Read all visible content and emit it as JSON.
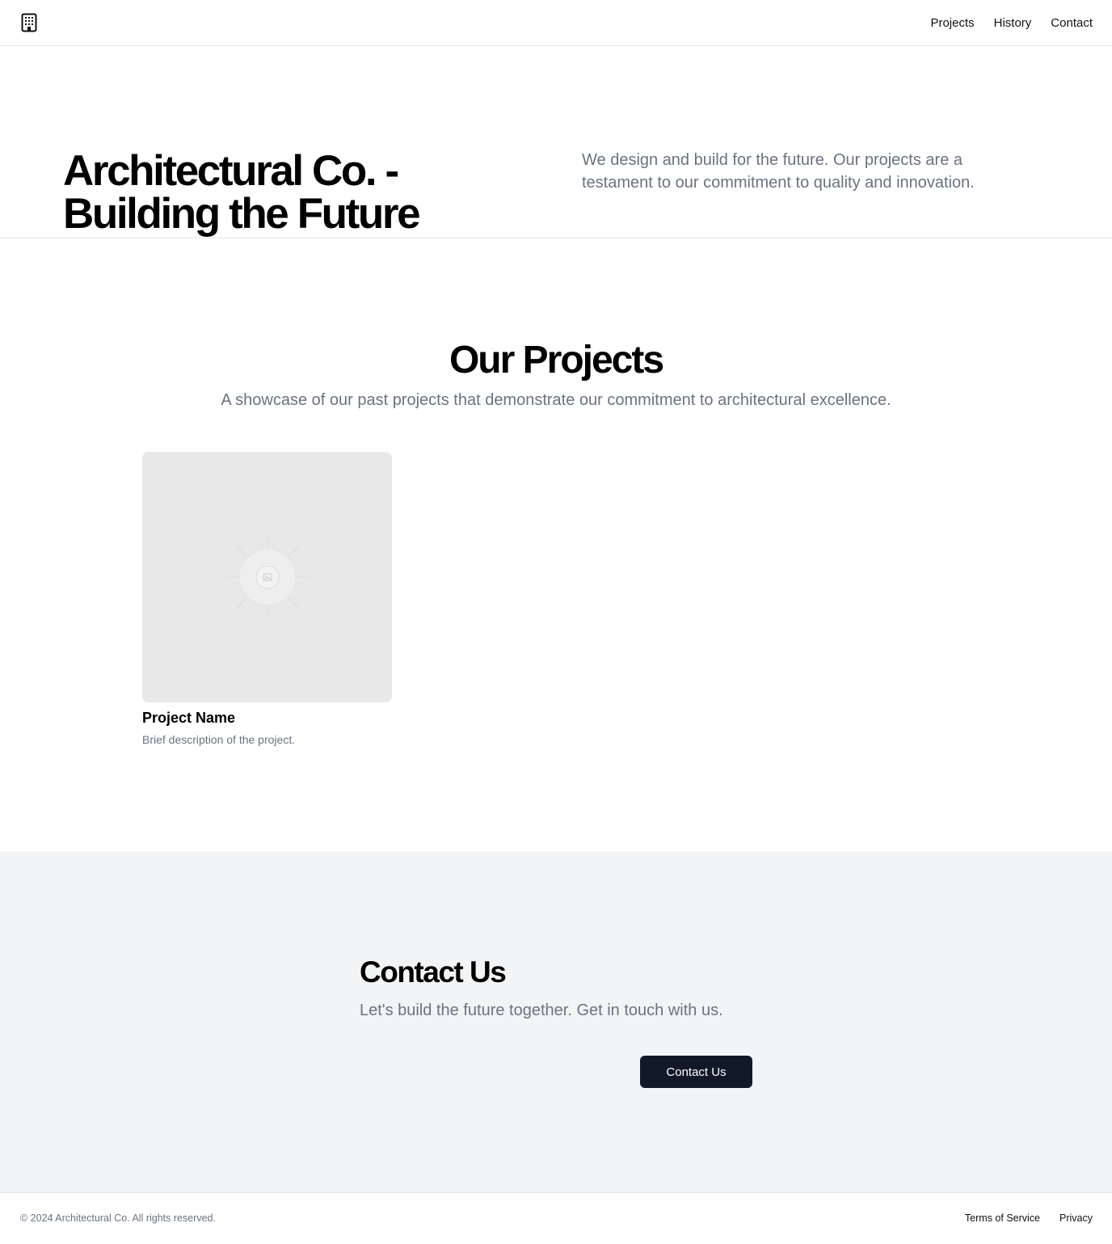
{
  "header": {
    "logo_icon": "building-icon",
    "nav": [
      {
        "label": "Projects"
      },
      {
        "label": "History"
      },
      {
        "label": "Contact"
      }
    ]
  },
  "hero": {
    "title": "Architectural Co. - Building the Future",
    "text": "We design and build for the future. Our projects are a testament to our commitment to quality and innovation."
  },
  "projects": {
    "title": "Our Projects",
    "subtitle": "A showcase of our past projects that demonstrate our commitment to architectural excellence.",
    "items": [
      {
        "name": "Project Name",
        "description": "Brief description of the project.",
        "image_icon": "image-placeholder-icon"
      }
    ]
  },
  "contact": {
    "title": "Contact Us",
    "subtitle": "Let's build the future together. Get in touch with us.",
    "button_label": "Contact Us",
    "button_color": "#111827",
    "background": "#f3f4f6"
  },
  "footer": {
    "copyright": "© 2024 Architectural Co. All rights reserved.",
    "links": [
      {
        "label": "Terms of Service"
      },
      {
        "label": "Privacy"
      }
    ]
  }
}
